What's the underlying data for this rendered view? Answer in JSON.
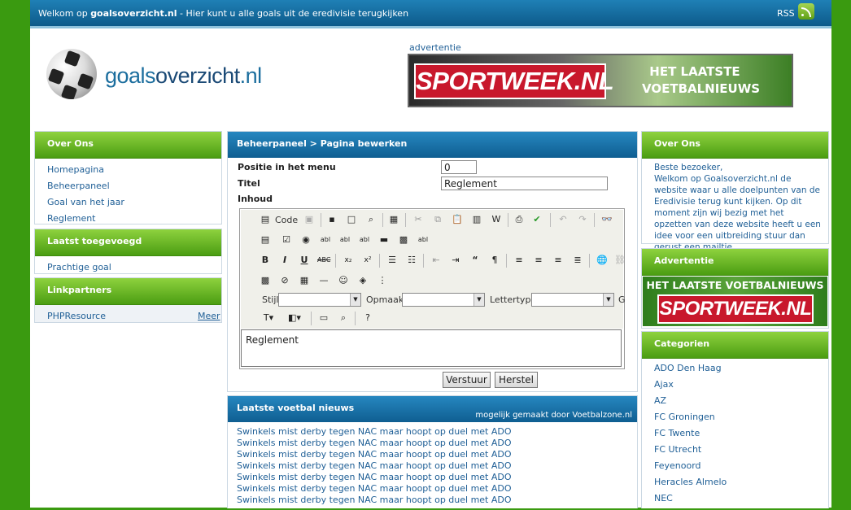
{
  "topbar": {
    "welcome_prefix": "Welkom op ",
    "site_bold": "goalsoverzicht.nl",
    "welcome_suffix": " - Hier kunt u alle goals uit de eredivisie terugkijken",
    "rss_label": "RSS"
  },
  "logo": {
    "part1": "goals",
    "part2": "overzicht",
    "part3": ".nl"
  },
  "header_ad": {
    "label": "advertentie",
    "logo_text": "SPORTWEEK.NL",
    "tagline_line1": "HET LAATSTE",
    "tagline_line2": "VOETBALNIEUWS"
  },
  "left": {
    "over_ons": {
      "title": "Over Ons",
      "items": [
        "Homepagina",
        "Beheerpaneel",
        "Goal van het jaar",
        "Reglement"
      ]
    },
    "laatst": {
      "title": "Laatst toegevoegd",
      "items": [
        "Prachtige goal"
      ]
    },
    "linkpartners": {
      "title": "Linkpartners",
      "item": "PHPResource",
      "more": "Meer"
    }
  },
  "panel": {
    "title": "Beheerpaneel > Pagina bewerken",
    "position_label": "Positie in het menu",
    "position_value": "0",
    "title_label": "Titel",
    "title_value": "Reglement",
    "content_label": "Inhoud",
    "editor": {
      "code_label": "Code",
      "stijl_label": "Stijl",
      "opmaak_label": "Opmaak",
      "lettertype_label": "Lettertype",
      "size_partial": "G",
      "content": "Reglement"
    },
    "submit_label": "Verstuur",
    "reset_label": "Herstel"
  },
  "news": {
    "title": "Laatste voetbal nieuws",
    "credit": "mogelijk gemaakt door Voetbalzone.nl",
    "items": [
      "Swinkels mist derby tegen NAC maar hoopt op duel met ADO",
      "Swinkels mist derby tegen NAC maar hoopt op duel met ADO",
      "Swinkels mist derby tegen NAC maar hoopt op duel met ADO",
      "Swinkels mist derby tegen NAC maar hoopt op duel met ADO",
      "Swinkels mist derby tegen NAC maar hoopt op duel met ADO",
      "Swinkels mist derby tegen NAC maar hoopt op duel met ADO",
      "Swinkels mist derby tegen NAC maar hoopt op duel met ADO"
    ]
  },
  "right": {
    "over_ons": {
      "title": "Over Ons",
      "text": "Beste bezoeker,\nWelkom op Goalsoverzicht.nl de website waar u alle doelpunten van de Eredivisie terug kunt kijken. Op dit moment zijn wij bezig met het opzetten van deze website heeft u een idee voor een uitbreiding stuur dan gerust een mailtje."
    },
    "advertentie": {
      "title": "Advertentie",
      "tagline": "HET LAATSTE VOETBALNIEUWS",
      "logo_text": "SPORTWEEK.NL"
    },
    "categorien": {
      "title": "Categorien",
      "items": [
        "ADO Den Haag",
        "Ajax",
        "AZ",
        "FC Groningen",
        "FC Twente",
        "FC Utrecht",
        "Feyenoord",
        "Heracles Almelo",
        "NEC"
      ]
    }
  },
  "colors": {
    "green_bg": "#3a9a10",
    "blue_bar": "#0d5a8a",
    "link": "#1f5f96",
    "sportweek_red": "#c8182c"
  }
}
